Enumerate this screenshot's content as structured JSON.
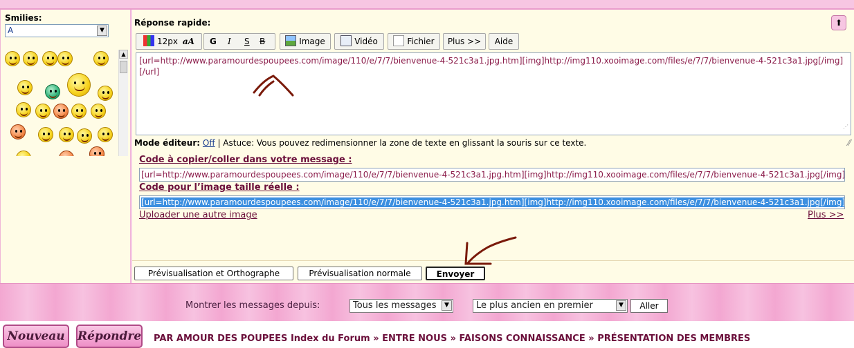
{
  "smilies": {
    "title": "Smilies:",
    "select_value": "A"
  },
  "quick_reply": {
    "title": "Réponse rapide:",
    "toolbar": {
      "font_size": "12px",
      "case_label": "aA",
      "bold": "G",
      "italic": "I",
      "underline": "S",
      "strike": "B",
      "image": "Image",
      "video": "Vidéo",
      "file": "Fichier",
      "more": "Plus >>",
      "help": "Aide"
    },
    "editor_text": "[url=http://www.paramourdespoupees.com/image/110/e/7/7/bienvenue-4-521c3a1.jpg.htm][img]http://img110.xooimage.com/files/e/7/7/bienvenue-4-521c3a1.jpg[/img][/url]",
    "mode_label": "Mode éditeur:",
    "mode_value": "Off",
    "tip": "| Astuce: Vous pouvez redimensionner la zone de texte en glissant la souris sur ce texte."
  },
  "codes": {
    "copy_label": "Code à copier/coller dans votre message :",
    "copy_value": "[url=http://www.paramourdespoupees.com/image/110/e/7/7/bienvenue-4-521c3a1.jpg.htm][img]http://img110.xooimage.com/files/e/7/7/bienvenue-4-521c3a1.jpg[/img][/url]",
    "full_label": "Code pour l’image taille réelle :",
    "full_value": "[url=http://www.paramourdespoupees.com/image/110/e/7/7/bienvenue-4-521c3a1.jpg.htm][img]http://img110.xooimage.com/files/e/7/7/bienvenue-4-521c3a1.jpg[/img][/url]",
    "upload_link": "Uploader une autre image",
    "more_link": "Plus >>"
  },
  "actions": {
    "preview_spell": "Prévisualisation et Orthographe",
    "preview": "Prévisualisation normale",
    "send": "Envoyer"
  },
  "filter": {
    "label": "Montrer les messages depuis:",
    "since_value": "Tous les messages",
    "order_value": "Le plus ancien en premier",
    "go": "Aller"
  },
  "footer": {
    "new_button": "Nouveau",
    "reply_button": "Répondre",
    "breadcrumb": [
      "PAR AMOUR DES POUPEES Index du Forum",
      "ENTRE NOUS",
      "FAISONS CONNAISSANCE",
      "PRÉSENTATION DES MEMBRES"
    ],
    "separator": "»"
  },
  "colors": {
    "accent": "#6b0f3b",
    "link": "#1b3e8f",
    "pink_band": "#f3a7d1",
    "panel_bg": "#fffce6",
    "annotation": "#7a1a0a"
  }
}
